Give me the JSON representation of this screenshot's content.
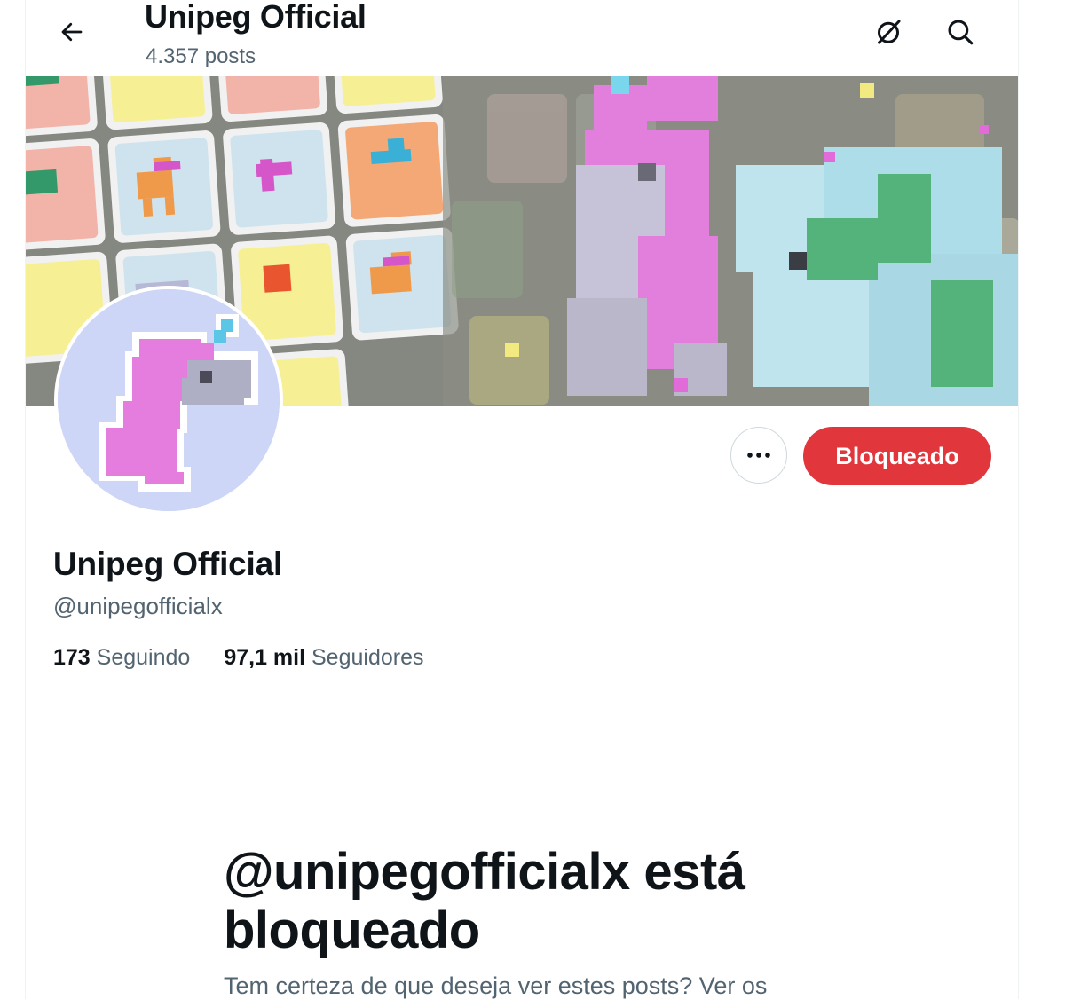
{
  "header": {
    "title": "Unipeg Official",
    "posts_count": "4.357 posts",
    "back_icon": "arrow-left-icon",
    "grok_icon": "grok-slash-icon",
    "search_icon": "search-icon"
  },
  "profile": {
    "name": "Unipeg Official",
    "handle": "@unipegofficialx",
    "following_count": "173",
    "following_label": "Seguindo",
    "followers_count": "97,1 mil",
    "followers_label": "Seguidores"
  },
  "actions": {
    "more_icon": "more-horizontal-icon",
    "blocked_label": "Bloqueado",
    "blocked_color": "#e0363c"
  },
  "blocked_notice": {
    "title": "@unipegofficialx está bloqueado",
    "description": "Tem certeza de que deseja ver estes posts? Ver os"
  },
  "colors": {
    "text_primary": "#0f1419",
    "text_secondary": "#536471",
    "avatar_bg": "#cdd6f6",
    "unicorn_pink": "#e47ddd"
  }
}
